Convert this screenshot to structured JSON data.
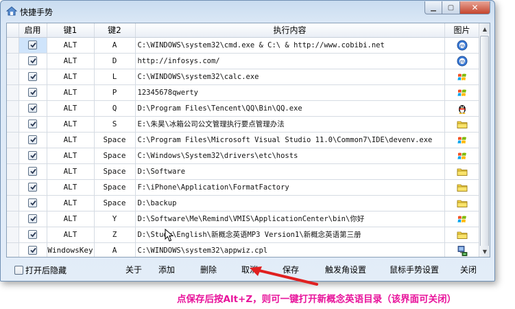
{
  "window": {
    "title": "快捷手势"
  },
  "columns": [
    "启用",
    "键1",
    "键2",
    "执行内容",
    "图片"
  ],
  "rows": [
    {
      "enabled": true,
      "key1": "ALT",
      "key2": "A",
      "content": "C:\\WINDOWS\\system32\\cmd.exe & C:\\ & http://www.cobibi.net",
      "icon": "ie-icon"
    },
    {
      "enabled": true,
      "key1": "ALT",
      "key2": "D",
      "content": "http://infosys.com/",
      "icon": "ie-icon"
    },
    {
      "enabled": true,
      "key1": "ALT",
      "key2": "L",
      "content": "C:\\WINDOWS\\system32\\calc.exe",
      "icon": "windows-logo-icon"
    },
    {
      "enabled": true,
      "key1": "ALT",
      "key2": "P",
      "content": "12345678qwerty",
      "icon": "windows-logo-icon"
    },
    {
      "enabled": true,
      "key1": "ALT",
      "key2": "Q",
      "content": "D:\\Program Files\\Tencent\\QQ\\Bin\\QQ.exe",
      "icon": "qq-penguin-icon"
    },
    {
      "enabled": true,
      "key1": "ALT",
      "key2": "S",
      "content": "E:\\朱昊\\冰箱公司公文管理执行要点管理办法",
      "icon": "folder-icon"
    },
    {
      "enabled": true,
      "key1": "ALT",
      "key2": "Space",
      "content": "C:\\Program Files\\Microsoft Visual Studio 11.0\\Common7\\IDE\\devenv.exe",
      "icon": "windows-logo-icon"
    },
    {
      "enabled": true,
      "key1": "ALT",
      "key2": "Space",
      "content": "C:\\Windows\\System32\\drivers\\etc\\hosts",
      "icon": "windows-logo-icon"
    },
    {
      "enabled": true,
      "key1": "ALT",
      "key2": "Space",
      "content": "D:\\Software",
      "icon": "folder-icon"
    },
    {
      "enabled": true,
      "key1": "ALT",
      "key2": "Space",
      "content": "F:\\iPhone\\Application\\FormatFactory",
      "icon": "folder-icon"
    },
    {
      "enabled": true,
      "key1": "ALT",
      "key2": "Space",
      "content": "D:\\backup",
      "icon": "folder-icon"
    },
    {
      "enabled": true,
      "key1": "ALT",
      "key2": "Y",
      "content": "D:\\Software\\Me\\Remind\\VMIS\\ApplicationCenter\\bin\\你好",
      "icon": "windows-logo-icon"
    },
    {
      "enabled": true,
      "key1": "ALT",
      "key2": "Z",
      "content": "D:\\Study\\English\\新概念英语MP3 Version1\\新概念英语第三册",
      "icon": "folder-icon"
    },
    {
      "enabled": true,
      "key1": "WindowsKey",
      "key2": "A",
      "content": "C:\\WINDOWS\\system32\\appwiz.cpl",
      "icon": "control-panel-icon"
    }
  ],
  "bottom": {
    "hide_on_open": "打开后隐藏",
    "buttons": [
      "关于",
      "添加",
      "删除",
      "取消",
      "保存",
      "触发角设置",
      "鼠标手势设置",
      "关闭"
    ]
  },
  "annotation": "点保存后按Alt+Z，则可一键打开新概念英语目录（该界面可关闭）",
  "colors": {
    "annotation": "#e8139b",
    "arrow": "#e02020"
  }
}
